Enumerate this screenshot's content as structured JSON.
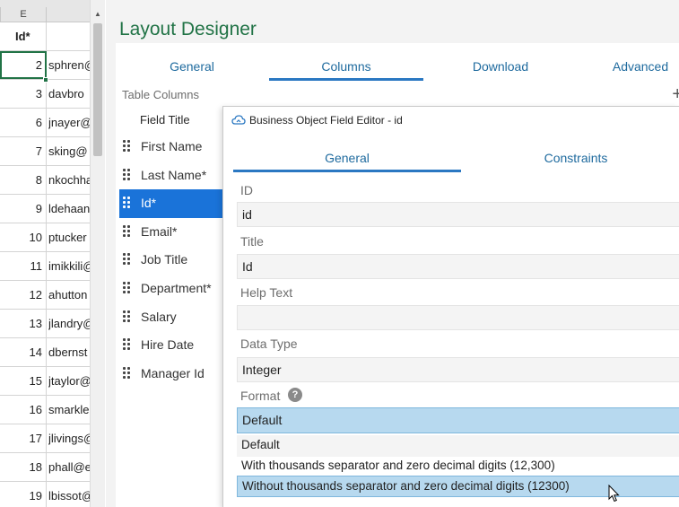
{
  "sheet": {
    "column_letter": "E",
    "header": "Id*",
    "rows": [
      {
        "num": "2",
        "email": "sphren@"
      },
      {
        "num": "3",
        "email": "davbro"
      },
      {
        "num": "6",
        "email": "jnayer@"
      },
      {
        "num": "7",
        "email": "sking@"
      },
      {
        "num": "8",
        "email": "nkochha"
      },
      {
        "num": "9",
        "email": "ldehaan"
      },
      {
        "num": "10",
        "email": "ptucker"
      },
      {
        "num": "11",
        "email": "imikkili@"
      },
      {
        "num": "12",
        "email": "ahutton"
      },
      {
        "num": "13",
        "email": "jlandry@"
      },
      {
        "num": "14",
        "email": "dbernst"
      },
      {
        "num": "15",
        "email": "jtaylor@"
      },
      {
        "num": "16",
        "email": "smarkle"
      },
      {
        "num": "17",
        "email": "jlivings@"
      },
      {
        "num": "18",
        "email": "phall@e"
      },
      {
        "num": "19",
        "email": "lbissot@"
      }
    ]
  },
  "designer": {
    "title": "Layout Designer",
    "tabs": [
      "General",
      "Columns",
      "Download",
      "Advanced"
    ],
    "active_tab": "Columns",
    "table_columns_label": "Table Columns",
    "field_title_header": "Field Title",
    "fields": [
      "First Name",
      "Last Name*",
      "Id*",
      "Email*",
      "Job Title",
      "Department*",
      "Salary",
      "Hire Date",
      "Manager Id"
    ],
    "selected_field": "Id*"
  },
  "dialog": {
    "title": "Business Object Field Editor - id",
    "tabs": [
      "General",
      "Constraints"
    ],
    "active_tab": "General",
    "id_label": "ID",
    "id_value": "id",
    "title_label": "Title",
    "title_value": "Id",
    "help_label": "Help Text",
    "help_value": "",
    "datatype_label": "Data Type",
    "datatype_value": "Integer",
    "format_label": "Format",
    "help_icon": "?",
    "format_value": "Default",
    "format_options": [
      "Default",
      "With thousands separator and zero decimal digits (12,300)",
      "Without thousands separator and zero decimal digits (12300)"
    ],
    "hovered_option": "Without thousands separator and zero decimal digits (12300)"
  },
  "colors": {
    "excel_green": "#217346",
    "tab_blue": "#2b78c2",
    "selection_blue": "#1a73d9",
    "option_highlight": "#b7d9ef"
  },
  "icons": [
    "cloud-icon",
    "help-icon",
    "add-icon",
    "drag-handle-icon",
    "scroll-up-icon",
    "mouse-cursor-icon"
  ]
}
